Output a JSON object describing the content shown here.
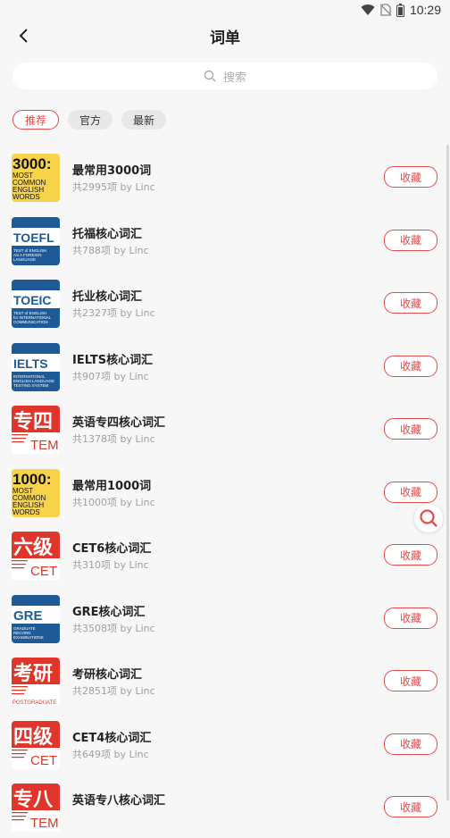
{
  "status": {
    "time": "10:29",
    "icons": [
      "wifi-icon",
      "no-sim-icon",
      "battery-icon"
    ]
  },
  "header": {
    "title": "词单",
    "back_icon": "back-arrow-icon"
  },
  "search": {
    "placeholder": "搜索",
    "icon": "search-icon"
  },
  "tabs": [
    {
      "label": "推荐",
      "active": true
    },
    {
      "label": "官方",
      "active": false
    },
    {
      "label": "最新",
      "active": false
    }
  ],
  "colors": {
    "accent": "#e64b4b"
  },
  "wordlists": [
    {
      "name": "最常用3000词",
      "meta": "共2995项 by Linc",
      "button": "收藏",
      "cover": {
        "style": "yellow",
        "big": "3000:",
        "lines": [
          "MOST",
          "COMMON",
          "ENGLISH",
          "WORDS"
        ]
      }
    },
    {
      "name": "托福核心词汇",
      "meta": "共788项 by Linc",
      "button": "收藏",
      "cover": {
        "style": "blue",
        "big": "TOEFL",
        "lines": [
          "TEST of ENGLISH",
          "AS A FOREIGN",
          "LANGUAGE"
        ]
      }
    },
    {
      "name": "托业核心词汇",
      "meta": "共2327项 by Linc",
      "button": "收藏",
      "cover": {
        "style": "blue",
        "big": "TOEIC",
        "lines": [
          "TEST of ENGLISH",
          "for INTERNATIONAL",
          "COMMUNICATION"
        ]
      }
    },
    {
      "name": "IELTS核心词汇",
      "meta": "共907项 by Linc",
      "button": "收藏",
      "cover": {
        "style": "blue",
        "big": "IELTS",
        "lines": [
          "INTERNATIONAL",
          "ENGLISH LANGUAGE",
          "TESTING SYSTEM"
        ]
      }
    },
    {
      "name": "英语专四核心词汇",
      "meta": "共1378项 by Linc",
      "button": "收藏",
      "cover": {
        "style": "red",
        "big": "专四",
        "tag": "TEM"
      }
    },
    {
      "name": "最常用1000词",
      "meta": "共1000项 by Linc",
      "button": "收藏",
      "cover": {
        "style": "yellow",
        "big": "1000:",
        "lines": [
          "MOST",
          "COMMON",
          "ENGLISH",
          "WORDS"
        ]
      }
    },
    {
      "name": "CET6核心词汇",
      "meta": "共310项 by Linc",
      "button": "收藏",
      "cover": {
        "style": "red",
        "big": "六级",
        "tag": "CET"
      }
    },
    {
      "name": "GRE核心词汇",
      "meta": "共3508项 by Linc",
      "button": "收藏",
      "cover": {
        "style": "blue",
        "big": "GRE",
        "lines": [
          "GRADUATE",
          "RECORD",
          "EXAMINATIONS"
        ]
      }
    },
    {
      "name": "考研核心词汇",
      "meta": "共2851项 by Linc",
      "button": "收藏",
      "cover": {
        "style": "red",
        "big": "考研",
        "tag": "POSTGRADUATE"
      }
    },
    {
      "name": "CET4核心词汇",
      "meta": "共649项 by Linc",
      "button": "收藏",
      "cover": {
        "style": "red",
        "big": "四级",
        "tag": "CET"
      }
    },
    {
      "name": "英语专八核心词汇",
      "meta": "",
      "button": "收藏",
      "cover": {
        "style": "red",
        "big": "专八",
        "tag": "TEM"
      }
    }
  ]
}
